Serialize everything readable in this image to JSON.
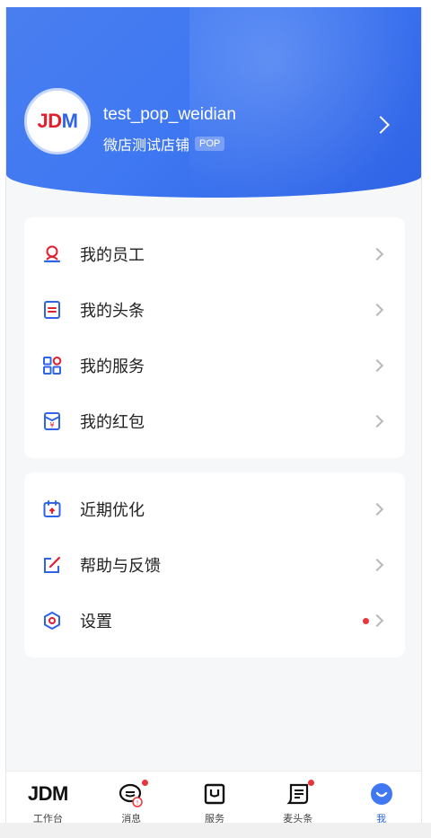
{
  "profile": {
    "username": "test_pop_weidian",
    "shop_name": "微店测试店铺",
    "badge": "POP",
    "avatar_logo_red": "JD",
    "avatar_logo_blue": "M"
  },
  "menu_group_1": [
    {
      "label": "我的员工",
      "icon": "staff-icon",
      "icon_color": "#e0202e"
    },
    {
      "label": "我的头条",
      "icon": "headline-icon",
      "icon_color": "#e0202e"
    },
    {
      "label": "我的服务",
      "icon": "services-grid-icon",
      "icon_color": "#2f64e8"
    },
    {
      "label": "我的红包",
      "icon": "red-packet-icon",
      "icon_color": "#2f64e8"
    }
  ],
  "menu_group_2": [
    {
      "label": "近期优化",
      "icon": "calendar-icon",
      "icon_color": "#2f64e8"
    },
    {
      "label": "帮助与反馈",
      "icon": "edit-feedback-icon",
      "icon_color": "#2f64e8"
    },
    {
      "label": "设置",
      "icon": "settings-icon",
      "icon_color": "#2f64e8",
      "has_dot": true
    }
  ],
  "tabbar": [
    {
      "label": "工作台",
      "icon": "jdm-logo-icon",
      "active": false,
      "mark": "JDM"
    },
    {
      "label": "消息",
      "icon": "message-icon",
      "active": false,
      "dot": true
    },
    {
      "label": "服务",
      "icon": "service-box-icon",
      "active": false
    },
    {
      "label": "麦头条",
      "icon": "news-icon",
      "active": false,
      "dot": true
    },
    {
      "label": "我",
      "icon": "me-icon",
      "active": true
    }
  ],
  "colors": {
    "header_blue": "#3f78f2",
    "accent_red": "#e0202e",
    "accent_blue": "#2f64e8"
  }
}
